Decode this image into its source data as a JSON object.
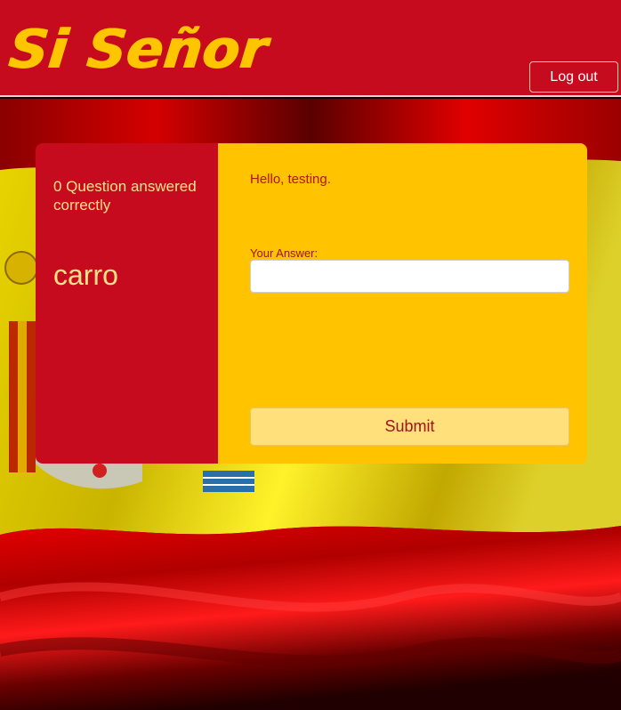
{
  "header": {
    "logo_text": "Si Señor",
    "logout_label": "Log out"
  },
  "quiz": {
    "score_text": "0 Question answered correctly",
    "word": "carro",
    "greeting": "Hello, testing.",
    "answer_label": "Your Answer:",
    "answer_value": "",
    "submit_label": "Submit"
  },
  "colors": {
    "header_red": "#c70b1f",
    "logo_yellow": "#ffc600",
    "panel_red": "#c70b1f",
    "panel_yellow": "#ffc300",
    "submit_bg": "#ffe07a"
  },
  "background": {
    "description_icon": "spanish-flag-background"
  }
}
